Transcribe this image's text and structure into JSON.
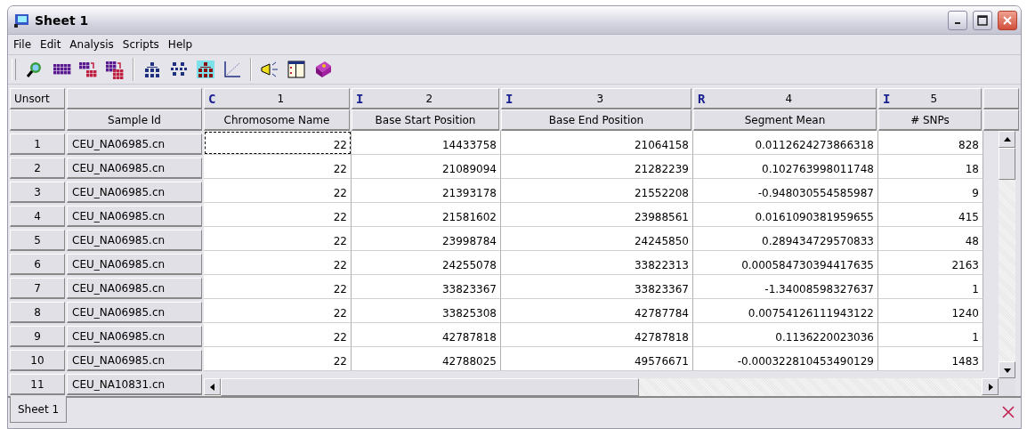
{
  "window": {
    "title": "Sheet 1"
  },
  "menu": [
    "File",
    "Edit",
    "Analysis",
    "Scripts",
    "Help"
  ],
  "grid": {
    "sort_label": "Unsort",
    "row_header_title": "Sample Id",
    "columns": [
      {
        "type": "C",
        "number": "1",
        "name": "Chromosome Name"
      },
      {
        "type": "I",
        "number": "2",
        "name": "Base Start Position"
      },
      {
        "type": "I",
        "number": "3",
        "name": "Base End Position"
      },
      {
        "type": "R",
        "number": "4",
        "name": "Segment Mean"
      },
      {
        "type": "I",
        "number": "5",
        "name": "# SNPs"
      }
    ],
    "rows": [
      {
        "index": "1",
        "sample": "CEU_NA06985.cn",
        "cells": [
          {
            "text": "22",
            "focused": true
          },
          {
            "text": "14433758",
            "focused": false
          },
          {
            "text": "21064158",
            "focused": false
          },
          {
            "text": "0.0112624273866318",
            "focused": false
          },
          {
            "text": "828",
            "focused": false
          }
        ]
      },
      {
        "index": "2",
        "sample": "CEU_NA06985.cn",
        "cells": [
          {
            "text": "22",
            "focused": false
          },
          {
            "text": "21089094",
            "focused": false
          },
          {
            "text": "21282239",
            "focused": false
          },
          {
            "text": "0.102763998011748",
            "focused": false
          },
          {
            "text": "18",
            "focused": false
          }
        ]
      },
      {
        "index": "3",
        "sample": "CEU_NA06985.cn",
        "cells": [
          {
            "text": "22",
            "focused": false
          },
          {
            "text": "21393178",
            "focused": false
          },
          {
            "text": "21552208",
            "focused": false
          },
          {
            "text": "-0.948030554585987",
            "focused": false
          },
          {
            "text": "9",
            "focused": false
          }
        ]
      },
      {
        "index": "4",
        "sample": "CEU_NA06985.cn",
        "cells": [
          {
            "text": "22",
            "focused": false
          },
          {
            "text": "21581602",
            "focused": false
          },
          {
            "text": "23988561",
            "focused": false
          },
          {
            "text": "0.0161090381959655",
            "focused": false
          },
          {
            "text": "415",
            "focused": false
          }
        ]
      },
      {
        "index": "5",
        "sample": "CEU_NA06985.cn",
        "cells": [
          {
            "text": "22",
            "focused": false
          },
          {
            "text": "23998784",
            "focused": false
          },
          {
            "text": "24245850",
            "focused": false
          },
          {
            "text": "0.289434729570833",
            "focused": false
          },
          {
            "text": "48",
            "focused": false
          }
        ]
      },
      {
        "index": "6",
        "sample": "CEU_NA06985.cn",
        "cells": [
          {
            "text": "22",
            "focused": false
          },
          {
            "text": "24255078",
            "focused": false
          },
          {
            "text": "33822313",
            "focused": false
          },
          {
            "text": "0.000584730394417635",
            "focused": false
          },
          {
            "text": "2163",
            "focused": false
          }
        ]
      },
      {
        "index": "7",
        "sample": "CEU_NA06985.cn",
        "cells": [
          {
            "text": "22",
            "focused": false
          },
          {
            "text": "33823367",
            "focused": false
          },
          {
            "text": "33823367",
            "focused": false
          },
          {
            "text": "-1.34008598327637",
            "focused": false
          },
          {
            "text": "1",
            "focused": false
          }
        ]
      },
      {
        "index": "8",
        "sample": "CEU_NA06985.cn",
        "cells": [
          {
            "text": "22",
            "focused": false
          },
          {
            "text": "33825308",
            "focused": false
          },
          {
            "text": "42787784",
            "focused": false
          },
          {
            "text": "0.00754126111943122",
            "focused": false
          },
          {
            "text": "1240",
            "focused": false
          }
        ]
      },
      {
        "index": "9",
        "sample": "CEU_NA06985.cn",
        "cells": [
          {
            "text": "22",
            "focused": false
          },
          {
            "text": "42787818",
            "focused": false
          },
          {
            "text": "42787818",
            "focused": false
          },
          {
            "text": "0.1136220023036",
            "focused": false
          },
          {
            "text": "1",
            "focused": false
          }
        ]
      },
      {
        "index": "10",
        "sample": "CEU_NA06985.cn",
        "cells": [
          {
            "text": "22",
            "focused": false
          },
          {
            "text": "42788025",
            "focused": false
          },
          {
            "text": "49576671",
            "focused": false
          },
          {
            "text": "-0.000322810453490129",
            "focused": false
          },
          {
            "text": "1483",
            "focused": false
          }
        ]
      },
      {
        "index": "11",
        "sample": "CEU_NA10831.cn"
      }
    ]
  },
  "sheet_tabs": [
    {
      "label": "Sheet 1",
      "selected": true
    }
  ]
}
